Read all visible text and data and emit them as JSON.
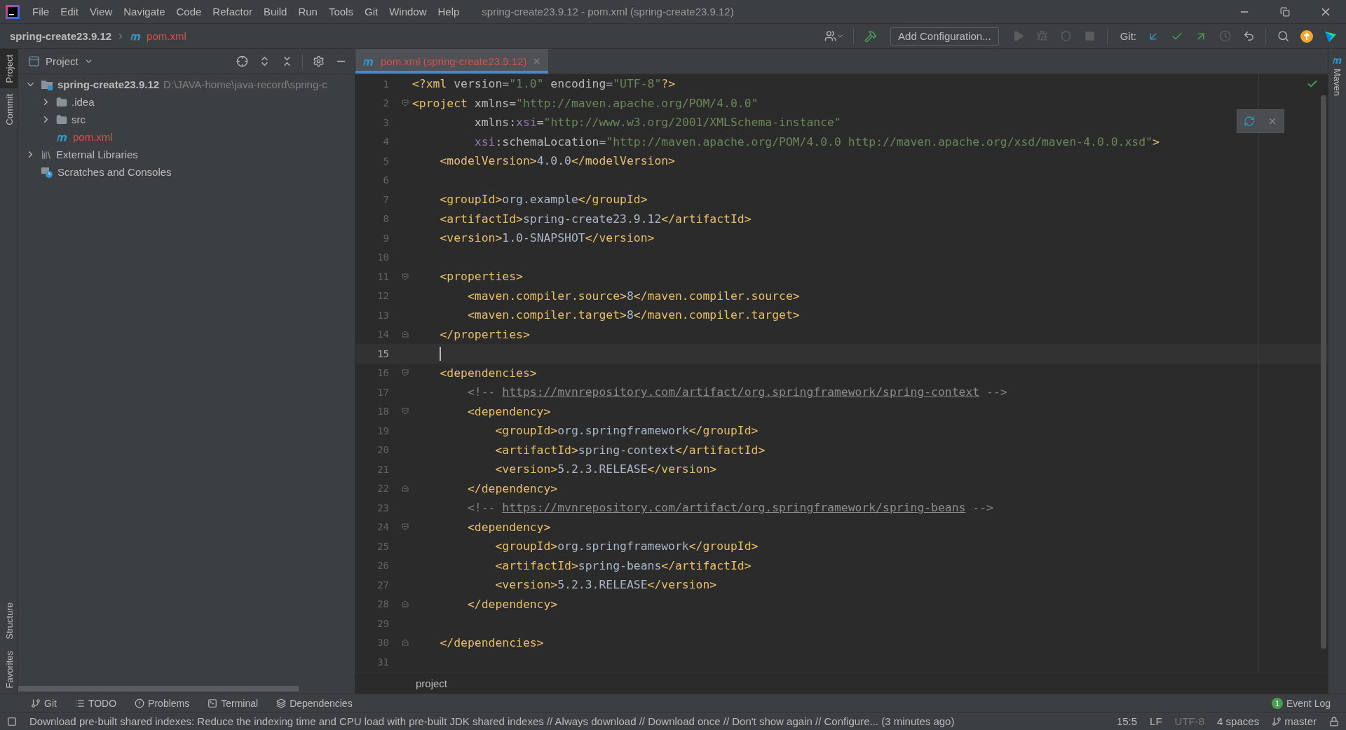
{
  "title_bar": {
    "menus": [
      "File",
      "Edit",
      "View",
      "Navigate",
      "Code",
      "Refactor",
      "Build",
      "Run",
      "Tools",
      "Git",
      "Window",
      "Help"
    ],
    "title": "spring-create23.9.12 - pom.xml (spring-create23.9.12)"
  },
  "nav_bar": {
    "project": "spring-create23.9.12",
    "file": "pom.xml",
    "run_config": "Add Configuration...",
    "git_label": "Git:"
  },
  "left_stripe": {
    "top": [
      {
        "label": "Project",
        "selected": true
      },
      {
        "label": "Commit",
        "selected": false
      }
    ],
    "bottom": [
      {
        "label": "Structure",
        "selected": false
      },
      {
        "label": "Favorites",
        "selected": false
      }
    ]
  },
  "right_stripe": {
    "label": "Maven"
  },
  "project_panel": {
    "title": "Project",
    "tree": [
      {
        "label": "spring-create23.9.12",
        "kind": "module",
        "path": "D:\\JAVA-home\\java-record\\spring-c",
        "expanded": true,
        "unversioned": false,
        "children": [
          {
            "label": ".idea",
            "kind": "folder",
            "expanded": false,
            "unversioned": false
          },
          {
            "label": "src",
            "kind": "folder",
            "expanded": false,
            "unversioned": false
          },
          {
            "label": "pom.xml",
            "kind": "maven",
            "unversioned": true
          }
        ]
      },
      {
        "label": "External Libraries",
        "kind": "libraries",
        "expanded": false,
        "unversioned": false
      },
      {
        "label": "Scratches and Consoles",
        "kind": "scratches",
        "unversioned": false
      }
    ]
  },
  "editor": {
    "tabs": [
      {
        "label": "pom.xml (spring-create23.9.12)",
        "selected": true,
        "unversioned": true
      }
    ],
    "lines": [
      {
        "number": "1",
        "current": false,
        "fold_start": false,
        "fold_end": false,
        "tokens": [
          {
            "kind": "tag",
            "text": "<?xml"
          },
          {
            "kind": "attr",
            "text": " version="
          },
          {
            "kind": "value",
            "text": "\"1.0\""
          },
          {
            "kind": "attr",
            "text": " encoding="
          },
          {
            "kind": "value",
            "text": "\"UTF-8\""
          },
          {
            "kind": "tag",
            "text": "?>"
          }
        ]
      },
      {
        "number": "2",
        "current": false,
        "fold_start": true,
        "fold_end": false,
        "tokens": [
          {
            "kind": "tag",
            "text": "<project"
          },
          {
            "kind": "attr",
            "text": " xmlns="
          },
          {
            "kind": "value",
            "text": "\"http://maven.apache.org/POM/4.0.0\""
          }
        ]
      },
      {
        "number": "3",
        "current": false,
        "fold_start": false,
        "fold_end": false,
        "tokens": [
          {
            "kind": "attr",
            "text": "         xmlns:"
          },
          {
            "kind": "ns",
            "text": "xsi"
          },
          {
            "kind": "attr",
            "text": "="
          },
          {
            "kind": "value",
            "text": "\"http://www.w3.org/2001/XMLSchema-instance\""
          }
        ]
      },
      {
        "number": "4",
        "current": false,
        "fold_start": false,
        "fold_end": false,
        "tokens": [
          {
            "kind": "ns",
            "text": "         xsi"
          },
          {
            "kind": "attr",
            "text": ":schemaLocation="
          },
          {
            "kind": "value",
            "text": "\"http://maven.apache.org/POM/4.0.0 http://maven.apache.org/xsd/maven-4.0.0.xsd\""
          },
          {
            "kind": "tag",
            "text": ">"
          }
        ]
      },
      {
        "number": "5",
        "current": false,
        "fold_start": false,
        "fold_end": false,
        "tokens": [
          {
            "kind": "tag",
            "text": "    <modelVersion>"
          },
          {
            "kind": "text",
            "text": "4.0.0"
          },
          {
            "kind": "tag",
            "text": "</modelVersion>"
          }
        ]
      },
      {
        "number": "6",
        "current": false,
        "fold_start": false,
        "fold_end": false
      },
      {
        "number": "7",
        "current": false,
        "fold_start": false,
        "fold_end": false,
        "tokens": [
          {
            "kind": "tag",
            "text": "    <groupId>"
          },
          {
            "kind": "text",
            "text": "org.example"
          },
          {
            "kind": "tag",
            "text": "</groupId>"
          }
        ]
      },
      {
        "number": "8",
        "current": false,
        "fold_start": false,
        "fold_end": false,
        "tokens": [
          {
            "kind": "tag",
            "text": "    <artifactId>"
          },
          {
            "kind": "text",
            "text": "spring-create23.9.12"
          },
          {
            "kind": "tag",
            "text": "</artifactId>"
          }
        ]
      },
      {
        "number": "9",
        "current": false,
        "fold_start": false,
        "fold_end": false,
        "tokens": [
          {
            "kind": "tag",
            "text": "    <version>"
          },
          {
            "kind": "text",
            "text": "1.0-SNAPSHOT"
          },
          {
            "kind": "tag",
            "text": "</version>"
          }
        ]
      },
      {
        "number": "10",
        "current": false,
        "fold_start": false,
        "fold_end": false
      },
      {
        "number": "11",
        "current": false,
        "fold_start": true,
        "fold_end": false,
        "tokens": [
          {
            "kind": "tag",
            "text": "    <properties>"
          }
        ]
      },
      {
        "number": "12",
        "current": false,
        "fold_start": false,
        "fold_end": false,
        "tokens": [
          {
            "kind": "tag",
            "text": "        <maven.compiler.source>"
          },
          {
            "kind": "text",
            "text": "8"
          },
          {
            "kind": "tag",
            "text": "</maven.compiler.source>"
          }
        ]
      },
      {
        "number": "13",
        "current": false,
        "fold_start": false,
        "fold_end": false,
        "tokens": [
          {
            "kind": "tag",
            "text": "        <maven.compiler.target>"
          },
          {
            "kind": "text",
            "text": "8"
          },
          {
            "kind": "tag",
            "text": "</maven.compiler.target>"
          }
        ]
      },
      {
        "number": "14",
        "current": false,
        "fold_start": false,
        "fold_end": true,
        "tokens": [
          {
            "kind": "tag",
            "text": "    </properties>"
          }
        ]
      },
      {
        "number": "15",
        "current": true,
        "fold_start": false,
        "fold_end": false
      },
      {
        "number": "16",
        "current": false,
        "fold_start": true,
        "fold_end": false,
        "tokens": [
          {
            "kind": "tag",
            "text": "    <dependencies>"
          }
        ]
      },
      {
        "number": "17",
        "current": false,
        "fold_start": false,
        "fold_end": false,
        "tokens": [
          {
            "kind": "comment",
            "text": "        <!-- "
          },
          {
            "kind": "link",
            "text": "https://mvnrepository.com/artifact/org.springframework/spring-context"
          },
          {
            "kind": "comment",
            "text": " -->"
          }
        ]
      },
      {
        "number": "18",
        "current": false,
        "fold_start": true,
        "fold_end": false,
        "tokens": [
          {
            "kind": "tag",
            "text": "        <dependency>"
          }
        ]
      },
      {
        "number": "19",
        "current": false,
        "fold_start": false,
        "fold_end": false,
        "tokens": [
          {
            "kind": "tag",
            "text": "            <groupId>"
          },
          {
            "kind": "text",
            "text": "org.springframework"
          },
          {
            "kind": "tag",
            "text": "</groupId>"
          }
        ]
      },
      {
        "number": "20",
        "current": false,
        "fold_start": false,
        "fold_end": false,
        "tokens": [
          {
            "kind": "tag",
            "text": "            <artifactId>"
          },
          {
            "kind": "text",
            "text": "spring-context"
          },
          {
            "kind": "tag",
            "text": "</artifactId>"
          }
        ]
      },
      {
        "number": "21",
        "current": false,
        "fold_start": false,
        "fold_end": false,
        "tokens": [
          {
            "kind": "tag",
            "text": "            <version>"
          },
          {
            "kind": "text",
            "text": "5.2.3.RELEASE"
          },
          {
            "kind": "tag",
            "text": "</version>"
          }
        ]
      },
      {
        "number": "22",
        "current": false,
        "fold_start": false,
        "fold_end": true,
        "tokens": [
          {
            "kind": "tag",
            "text": "        </dependency>"
          }
        ]
      },
      {
        "number": "23",
        "current": false,
        "fold_start": false,
        "fold_end": false,
        "tokens": [
          {
            "kind": "comment",
            "text": "        <!-- "
          },
          {
            "kind": "link",
            "text": "https://mvnrepository.com/artifact/org.springframework/spring-beans"
          },
          {
            "kind": "comment",
            "text": " -->"
          }
        ]
      },
      {
        "number": "24",
        "current": false,
        "fold_start": true,
        "fold_end": false,
        "tokens": [
          {
            "kind": "tag",
            "text": "        <dependency>"
          }
        ]
      },
      {
        "number": "25",
        "current": false,
        "fold_start": false,
        "fold_end": false,
        "tokens": [
          {
            "kind": "tag",
            "text": "            <groupId>"
          },
          {
            "kind": "text",
            "text": "org.springframework"
          },
          {
            "kind": "tag",
            "text": "</groupId>"
          }
        ]
      },
      {
        "number": "26",
        "current": false,
        "fold_start": false,
        "fold_end": false,
        "tokens": [
          {
            "kind": "tag",
            "text": "            <artifactId>"
          },
          {
            "kind": "text",
            "text": "spring-beans"
          },
          {
            "kind": "tag",
            "text": "</artifactId>"
          }
        ]
      },
      {
        "number": "27",
        "current": false,
        "fold_start": false,
        "fold_end": false,
        "tokens": [
          {
            "kind": "tag",
            "text": "            <version>"
          },
          {
            "kind": "text",
            "text": "5.2.3.RELEASE"
          },
          {
            "kind": "tag",
            "text": "</version>"
          }
        ]
      },
      {
        "number": "28",
        "current": false,
        "fold_start": false,
        "fold_end": true,
        "tokens": [
          {
            "kind": "tag",
            "text": "        </dependency>"
          }
        ]
      },
      {
        "number": "29",
        "current": false,
        "fold_start": false,
        "fold_end": false
      },
      {
        "number": "30",
        "current": false,
        "fold_start": false,
        "fold_end": true,
        "tokens": [
          {
            "kind": "tag",
            "text": "    </dependencies>"
          }
        ]
      },
      {
        "number": "31",
        "current": false,
        "fold_start": false,
        "fold_end": false
      }
    ],
    "breadcrumb": "project"
  },
  "tool_windows": [
    {
      "label": "Git",
      "kind": "git"
    },
    {
      "label": "TODO",
      "kind": "todo"
    },
    {
      "label": "Problems",
      "kind": "problems"
    },
    {
      "label": "Terminal",
      "kind": "terminal"
    },
    {
      "label": "Dependencies",
      "kind": "dependencies"
    }
  ],
  "event_log": {
    "label": "Event Log",
    "count": "1"
  },
  "status_bar": {
    "message": "Download pre-built shared indexes: Reduce the indexing time and CPU load with pre-built JDK shared indexes // Always download // Download once // Don't show again // Configure... (3 minutes ago)",
    "position": "15:5",
    "line_separator": "LF",
    "encoding": "UTF-8",
    "indent": "4 spaces",
    "branch": "master"
  }
}
